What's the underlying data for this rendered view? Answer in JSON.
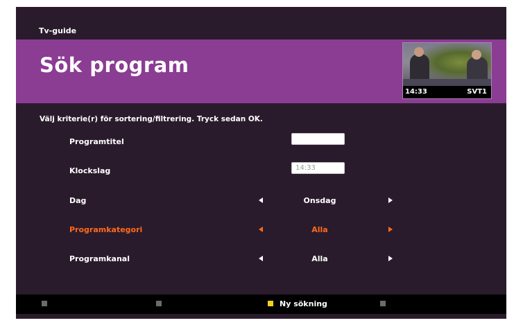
{
  "header": {
    "breadcrumb": "Tv-guide",
    "title": "Sök program"
  },
  "preview": {
    "time": "14:33",
    "channel": "SVT1"
  },
  "instructions": "Välj kriterie(r) för sortering/filtrering. Tryck sedan OK.",
  "criteria": {
    "programtitel": {
      "label": "Programtitel",
      "value": ""
    },
    "klockslag": {
      "label": "Klockslag",
      "value": "14:33"
    },
    "dag": {
      "label": "Dag",
      "value": "Onsdag"
    },
    "programkategori": {
      "label": "Programkategori",
      "value": "Alla",
      "selected": true
    },
    "programkanal": {
      "label": "Programkanal",
      "value": "Alla"
    }
  },
  "footer": {
    "buttons": [
      {
        "color": "grey",
        "label": ""
      },
      {
        "color": "grey",
        "label": ""
      },
      {
        "color": "yellow",
        "label": "Ny sökning"
      },
      {
        "color": "grey",
        "label": ""
      }
    ]
  },
  "colors": {
    "background": "#2a1b2c",
    "title_band": "#8b3c93",
    "highlight": "#ff6a1a",
    "footer_yellow": "#f0d21b"
  }
}
